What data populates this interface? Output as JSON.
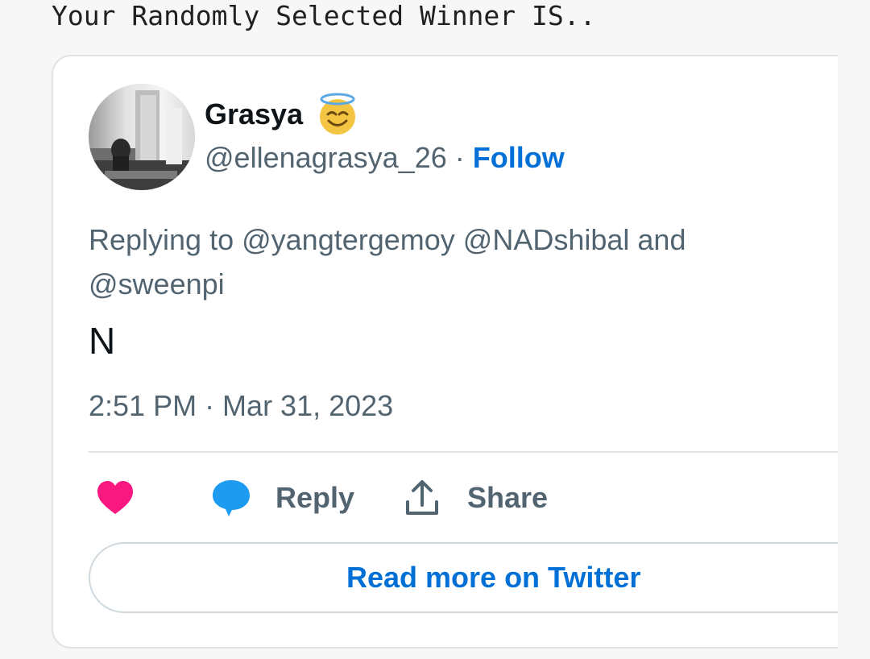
{
  "page": {
    "heading": "Your Randomly Selected Winner IS.."
  },
  "tweet": {
    "author": {
      "display_name": "Grasya",
      "emoji": "smiling-face-with-halo",
      "handle": "@ellenagrasya_26",
      "separator": "·",
      "follow_label": "Follow"
    },
    "replying_to": "Replying to @yangtergemoy @NADshibal and @sweenpi",
    "text": "N",
    "timestamp": "2:51 PM · Mar 31, 2023",
    "actions": {
      "like_icon": "heart-icon",
      "reply_label": "Reply",
      "reply_icon": "speech-bubble-icon",
      "share_label": "Share",
      "share_icon": "upload-icon"
    },
    "read_more_label": "Read more on Twitter"
  },
  "colors": {
    "link": "#006fd6",
    "muted": "#536471",
    "text": "#0f1419",
    "like": "#f91880",
    "reply": "#1d9bf0",
    "border": "#dfe3e6"
  }
}
